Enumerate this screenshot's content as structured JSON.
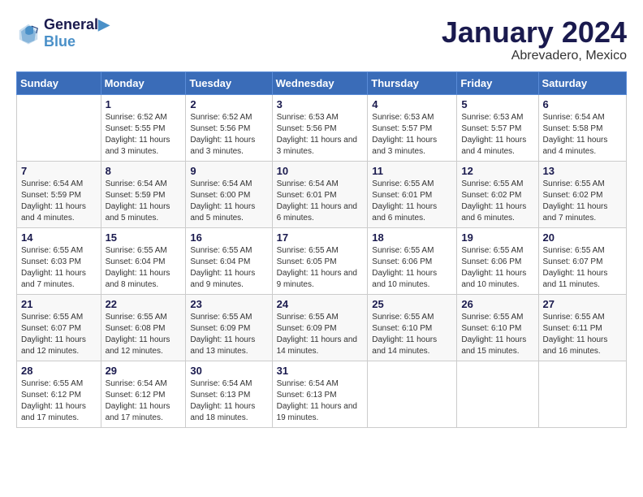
{
  "header": {
    "logo_line1": "General",
    "logo_line2": "Blue",
    "month": "January 2024",
    "location": "Abrevadero, Mexico"
  },
  "weekdays": [
    "Sunday",
    "Monday",
    "Tuesday",
    "Wednesday",
    "Thursday",
    "Friday",
    "Saturday"
  ],
  "weeks": [
    [
      {
        "day": "",
        "sunrise": "",
        "sunset": "",
        "daylight": ""
      },
      {
        "day": "1",
        "sunrise": "Sunrise: 6:52 AM",
        "sunset": "Sunset: 5:55 PM",
        "daylight": "Daylight: 11 hours and 3 minutes."
      },
      {
        "day": "2",
        "sunrise": "Sunrise: 6:52 AM",
        "sunset": "Sunset: 5:56 PM",
        "daylight": "Daylight: 11 hours and 3 minutes."
      },
      {
        "day": "3",
        "sunrise": "Sunrise: 6:53 AM",
        "sunset": "Sunset: 5:56 PM",
        "daylight": "Daylight: 11 hours and 3 minutes."
      },
      {
        "day": "4",
        "sunrise": "Sunrise: 6:53 AM",
        "sunset": "Sunset: 5:57 PM",
        "daylight": "Daylight: 11 hours and 3 minutes."
      },
      {
        "day": "5",
        "sunrise": "Sunrise: 6:53 AM",
        "sunset": "Sunset: 5:57 PM",
        "daylight": "Daylight: 11 hours and 4 minutes."
      },
      {
        "day": "6",
        "sunrise": "Sunrise: 6:54 AM",
        "sunset": "Sunset: 5:58 PM",
        "daylight": "Daylight: 11 hours and 4 minutes."
      }
    ],
    [
      {
        "day": "7",
        "sunrise": "Sunrise: 6:54 AM",
        "sunset": "Sunset: 5:59 PM",
        "daylight": "Daylight: 11 hours and 4 minutes."
      },
      {
        "day": "8",
        "sunrise": "Sunrise: 6:54 AM",
        "sunset": "Sunset: 5:59 PM",
        "daylight": "Daylight: 11 hours and 5 minutes."
      },
      {
        "day": "9",
        "sunrise": "Sunrise: 6:54 AM",
        "sunset": "Sunset: 6:00 PM",
        "daylight": "Daylight: 11 hours and 5 minutes."
      },
      {
        "day": "10",
        "sunrise": "Sunrise: 6:54 AM",
        "sunset": "Sunset: 6:01 PM",
        "daylight": "Daylight: 11 hours and 6 minutes."
      },
      {
        "day": "11",
        "sunrise": "Sunrise: 6:55 AM",
        "sunset": "Sunset: 6:01 PM",
        "daylight": "Daylight: 11 hours and 6 minutes."
      },
      {
        "day": "12",
        "sunrise": "Sunrise: 6:55 AM",
        "sunset": "Sunset: 6:02 PM",
        "daylight": "Daylight: 11 hours and 6 minutes."
      },
      {
        "day": "13",
        "sunrise": "Sunrise: 6:55 AM",
        "sunset": "Sunset: 6:02 PM",
        "daylight": "Daylight: 11 hours and 7 minutes."
      }
    ],
    [
      {
        "day": "14",
        "sunrise": "Sunrise: 6:55 AM",
        "sunset": "Sunset: 6:03 PM",
        "daylight": "Daylight: 11 hours and 7 minutes."
      },
      {
        "day": "15",
        "sunrise": "Sunrise: 6:55 AM",
        "sunset": "Sunset: 6:04 PM",
        "daylight": "Daylight: 11 hours and 8 minutes."
      },
      {
        "day": "16",
        "sunrise": "Sunrise: 6:55 AM",
        "sunset": "Sunset: 6:04 PM",
        "daylight": "Daylight: 11 hours and 9 minutes."
      },
      {
        "day": "17",
        "sunrise": "Sunrise: 6:55 AM",
        "sunset": "Sunset: 6:05 PM",
        "daylight": "Daylight: 11 hours and 9 minutes."
      },
      {
        "day": "18",
        "sunrise": "Sunrise: 6:55 AM",
        "sunset": "Sunset: 6:06 PM",
        "daylight": "Daylight: 11 hours and 10 minutes."
      },
      {
        "day": "19",
        "sunrise": "Sunrise: 6:55 AM",
        "sunset": "Sunset: 6:06 PM",
        "daylight": "Daylight: 11 hours and 10 minutes."
      },
      {
        "day": "20",
        "sunrise": "Sunrise: 6:55 AM",
        "sunset": "Sunset: 6:07 PM",
        "daylight": "Daylight: 11 hours and 11 minutes."
      }
    ],
    [
      {
        "day": "21",
        "sunrise": "Sunrise: 6:55 AM",
        "sunset": "Sunset: 6:07 PM",
        "daylight": "Daylight: 11 hours and 12 minutes."
      },
      {
        "day": "22",
        "sunrise": "Sunrise: 6:55 AM",
        "sunset": "Sunset: 6:08 PM",
        "daylight": "Daylight: 11 hours and 12 minutes."
      },
      {
        "day": "23",
        "sunrise": "Sunrise: 6:55 AM",
        "sunset": "Sunset: 6:09 PM",
        "daylight": "Daylight: 11 hours and 13 minutes."
      },
      {
        "day": "24",
        "sunrise": "Sunrise: 6:55 AM",
        "sunset": "Sunset: 6:09 PM",
        "daylight": "Daylight: 11 hours and 14 minutes."
      },
      {
        "day": "25",
        "sunrise": "Sunrise: 6:55 AM",
        "sunset": "Sunset: 6:10 PM",
        "daylight": "Daylight: 11 hours and 14 minutes."
      },
      {
        "day": "26",
        "sunrise": "Sunrise: 6:55 AM",
        "sunset": "Sunset: 6:10 PM",
        "daylight": "Daylight: 11 hours and 15 minutes."
      },
      {
        "day": "27",
        "sunrise": "Sunrise: 6:55 AM",
        "sunset": "Sunset: 6:11 PM",
        "daylight": "Daylight: 11 hours and 16 minutes."
      }
    ],
    [
      {
        "day": "28",
        "sunrise": "Sunrise: 6:55 AM",
        "sunset": "Sunset: 6:12 PM",
        "daylight": "Daylight: 11 hours and 17 minutes."
      },
      {
        "day": "29",
        "sunrise": "Sunrise: 6:54 AM",
        "sunset": "Sunset: 6:12 PM",
        "daylight": "Daylight: 11 hours and 17 minutes."
      },
      {
        "day": "30",
        "sunrise": "Sunrise: 6:54 AM",
        "sunset": "Sunset: 6:13 PM",
        "daylight": "Daylight: 11 hours and 18 minutes."
      },
      {
        "day": "31",
        "sunrise": "Sunrise: 6:54 AM",
        "sunset": "Sunset: 6:13 PM",
        "daylight": "Daylight: 11 hours and 19 minutes."
      },
      {
        "day": "",
        "sunrise": "",
        "sunset": "",
        "daylight": ""
      },
      {
        "day": "",
        "sunrise": "",
        "sunset": "",
        "daylight": ""
      },
      {
        "day": "",
        "sunrise": "",
        "sunset": "",
        "daylight": ""
      }
    ]
  ]
}
